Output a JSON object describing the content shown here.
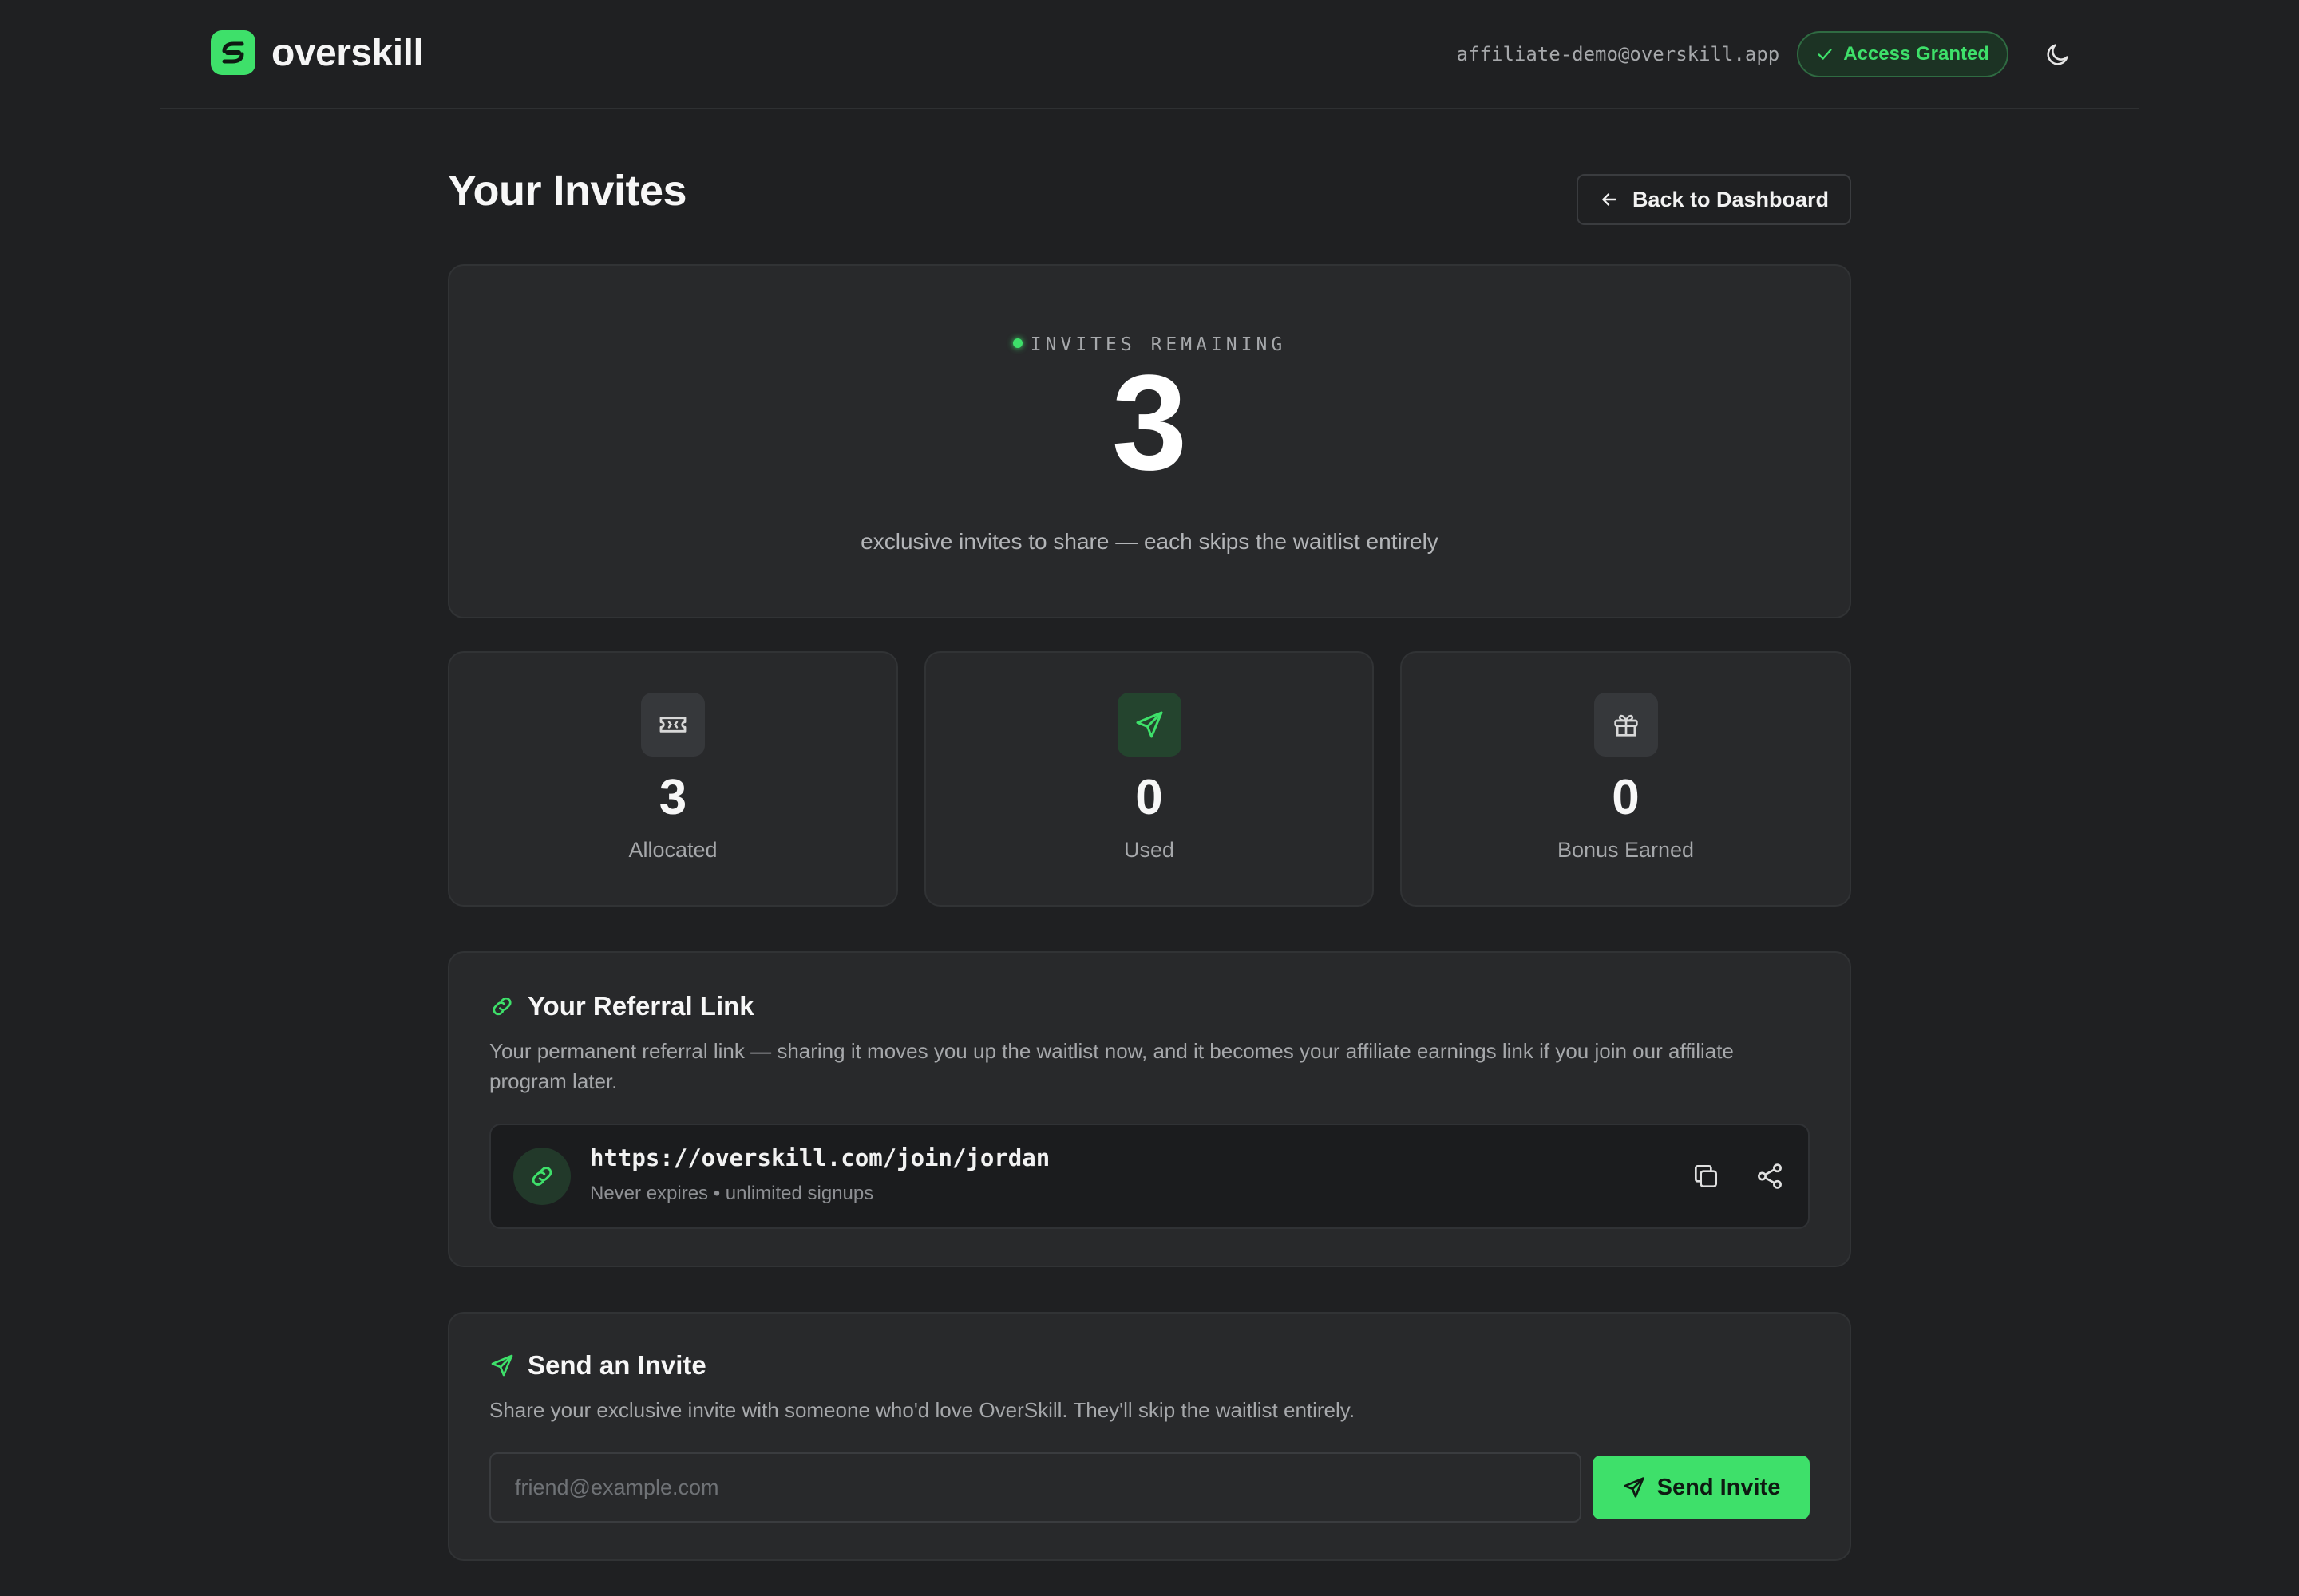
{
  "app": {
    "brand": "overskill"
  },
  "header": {
    "email": "affiliate-demo@overskill.app",
    "access_badge": "Access Granted"
  },
  "page": {
    "title": "Your Invites",
    "back_label": "Back to Dashboard"
  },
  "hero": {
    "label": "INVITES REMAINING",
    "count": "3",
    "subtitle": "exclusive invites to share — each skips the waitlist entirely"
  },
  "stats": [
    {
      "value": "3",
      "label": "Allocated",
      "icon": "ticket-icon"
    },
    {
      "value": "0",
      "label": "Used",
      "icon": "send-icon"
    },
    {
      "value": "0",
      "label": "Bonus Earned",
      "icon": "gift-icon"
    }
  ],
  "referral": {
    "title": "Your Referral Link",
    "description": "Your permanent referral link — sharing it moves you up the waitlist now, and it becomes your affiliate earnings link if you join our affiliate program later.",
    "url": "https://overskill.com/join/jordan",
    "meta": "Never expires • unlimited signups"
  },
  "invite": {
    "title": "Send an Invite",
    "description": "Share your exclusive invite with someone who'd love OverSkill. They'll skip the waitlist entirely.",
    "email_placeholder": "friend@example.com",
    "email_value": "",
    "button_label": "Send Invite"
  },
  "colors": {
    "background": "#1f2022",
    "card": "#28292b",
    "accent": "#3ee06a",
    "muted_text": "#a6a8ab"
  }
}
